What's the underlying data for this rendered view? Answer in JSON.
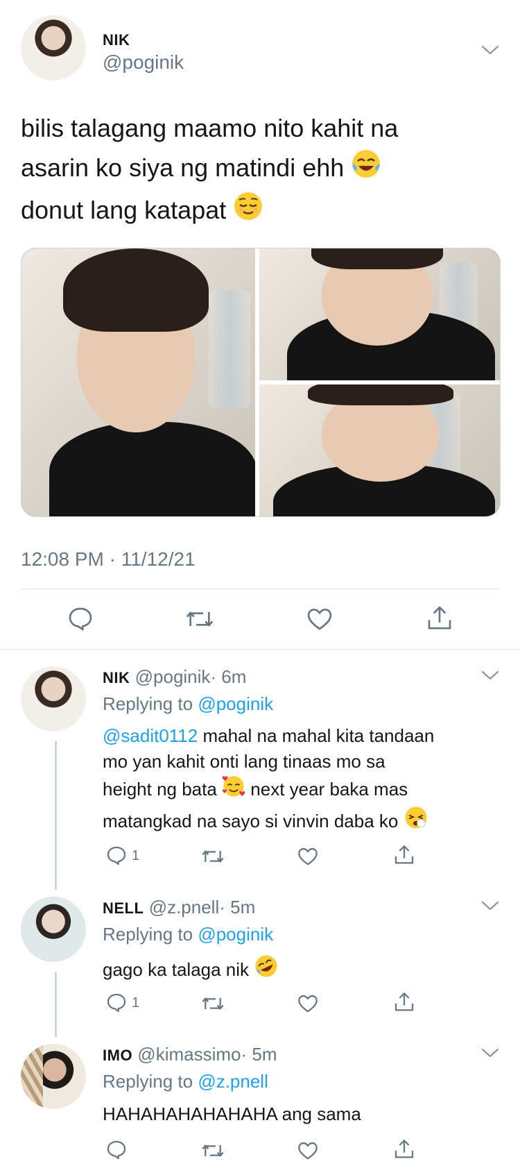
{
  "main_tweet": {
    "display_name": "NIK",
    "handle": "@poginik",
    "text_lines": [
      "bilis talagang maamo nito kahit na",
      "asarin ko siya ng matindi ehh",
      "donut lang katapat"
    ],
    "timestamp": "12:08 PM · 11/12/21"
  },
  "actions": {
    "reply_icon": "reply-icon",
    "retweet_icon": "retweet-icon",
    "like_icon": "heart-icon",
    "share_icon": "share-icon"
  },
  "replies": [
    {
      "display_name": "NIK",
      "handle": "@poginik",
      "time": "· 6m",
      "replying_prefix": "Replying to",
      "replying_to": "@poginik",
      "mention": "@sadit0112",
      "lines": [
        " mahal na mahal kita tandaan",
        "mo yan kahit onti lang tinaas mo sa",
        "height ng bata",
        " next year baka mas",
        "matangkad na sayo si vinvin daba ko"
      ],
      "reply_count": "1"
    },
    {
      "display_name": "NELL",
      "handle": "@z.pnell",
      "time": "· 5m",
      "replying_prefix": "Replying to",
      "replying_to": "@poginik",
      "text": "gago ka talaga nik",
      "reply_count": "1"
    },
    {
      "display_name": "IMO",
      "handle": "@kimassimo",
      "time": "· 5m",
      "replying_prefix": "Replying to",
      "replying_to": "@z.pnell",
      "text": "HAHAHAHAHAHAHA ang sama",
      "reply_count": ""
    }
  ],
  "colors": {
    "accent": "#1da1f2",
    "secondary_text": "#657786",
    "divider": "#e1e8ed"
  }
}
